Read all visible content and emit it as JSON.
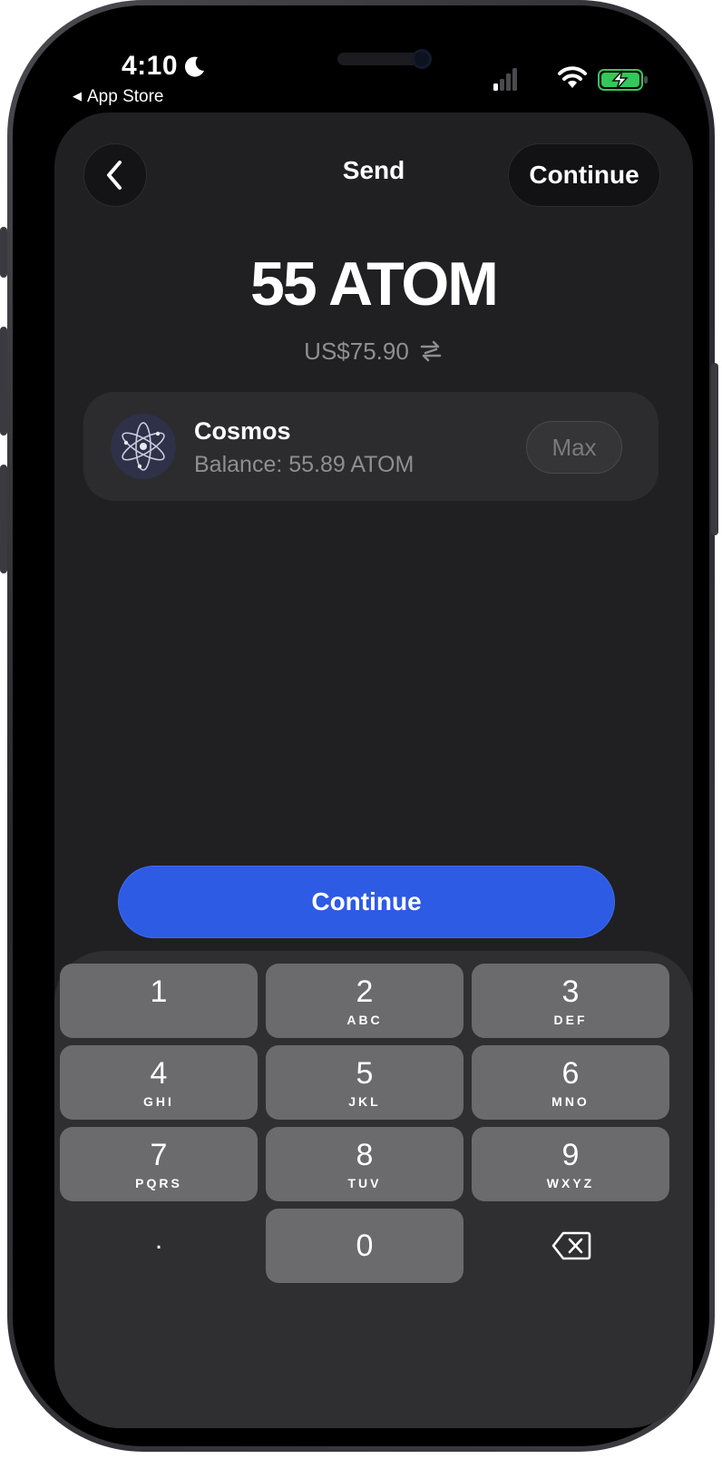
{
  "status_bar": {
    "time": "4:10",
    "back_label": "App Store"
  },
  "header": {
    "title": "Send",
    "continue_label": "Continue"
  },
  "amount": {
    "value": "55 ATOM",
    "fiat": "US$75.90"
  },
  "token": {
    "name": "Cosmos",
    "balance": "Balance: 55.89 ATOM",
    "max_label": "Max"
  },
  "primary_action": {
    "label": "Continue",
    "color": "#2d5be3"
  },
  "keypad": {
    "keys": [
      {
        "num": "1",
        "letters": ""
      },
      {
        "num": "2",
        "letters": "ABC"
      },
      {
        "num": "3",
        "letters": "DEF"
      },
      {
        "num": "4",
        "letters": "GHI"
      },
      {
        "num": "5",
        "letters": "JKL"
      },
      {
        "num": "6",
        "letters": "MNO"
      },
      {
        "num": "7",
        "letters": "PQRS"
      },
      {
        "num": "8",
        "letters": "TUV"
      },
      {
        "num": "9",
        "letters": "WXYZ"
      },
      {
        "num": ".",
        "letters": ""
      },
      {
        "num": "0",
        "letters": ""
      },
      {
        "num": "delete-icon",
        "letters": ""
      }
    ]
  },
  "colors": {
    "background": "#202022",
    "card": "#2c2c2e",
    "secondary_text": "#8e8e93",
    "battery_charge": "#34c759"
  }
}
